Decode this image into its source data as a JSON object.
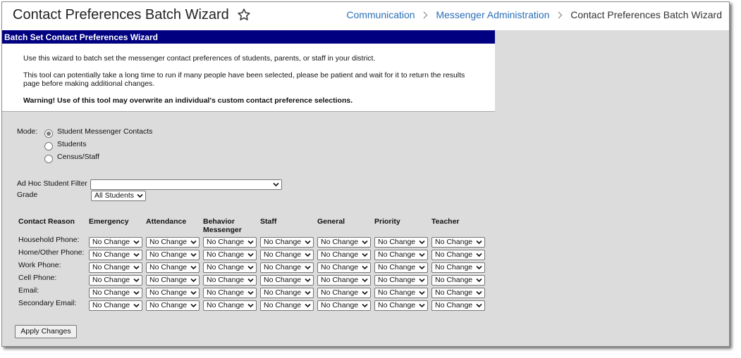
{
  "header": {
    "title": "Contact Preferences Batch Wizard",
    "breadcrumb": [
      "Communication",
      "Messenger Administration",
      "Contact Preferences Batch Wizard"
    ]
  },
  "wizard": {
    "title": "Batch Set Contact Preferences Wizard",
    "intro1": "Use this wizard to batch set the messenger contact preferences of students, parents, or staff in your district.",
    "intro2": "This tool can potentially take a long time to run if many people have been selected, please be patient and wait for it to return the results page before making additional changes.",
    "warning": "Warning! Use of this tool may overwrite an individual's custom contact preference selections."
  },
  "mode": {
    "label": "Mode:",
    "options": [
      "Student Messenger Contacts",
      "Students",
      "Census/Staff"
    ],
    "selected": 0
  },
  "filters": {
    "adhoc_label": "Ad Hoc Student Filter",
    "adhoc_value": "",
    "grade_label": "Grade",
    "grade_value": "All Students"
  },
  "table": {
    "reason_header": "Contact Reason",
    "columns": [
      "Emergency",
      "Attendance",
      "Behavior Messenger",
      "Staff",
      "General",
      "Priority",
      "Teacher"
    ],
    "rows": [
      "Household Phone:",
      "Home/Other Phone:",
      "Work Phone:",
      "Cell Phone:",
      "Email:",
      "Secondary Email:"
    ],
    "default_value": "No Change"
  },
  "apply_label": "Apply Changes",
  "colors": {
    "accent": "#2b6fb6",
    "header_bg": "#000080",
    "panel_bg": "#dcdcdc"
  }
}
